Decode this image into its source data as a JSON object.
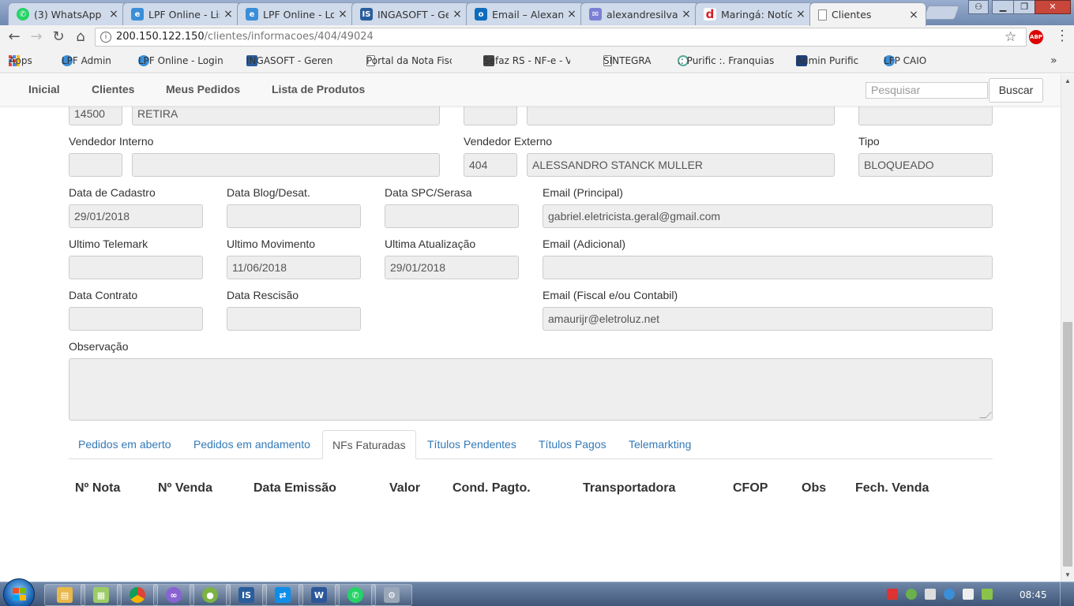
{
  "browser": {
    "tabs": [
      {
        "title": "(3) WhatsApp",
        "icon": "whatsapp-icon",
        "color": "#25d366"
      },
      {
        "title": "LPF Online - List",
        "icon": "lpf-icon",
        "color": "#3b8ed8"
      },
      {
        "title": "LPF Online - Loja",
        "icon": "lpf-icon",
        "color": "#3b8ed8"
      },
      {
        "title": "INGASOFT - Ger",
        "icon": "ingasoft-icon",
        "color": "#2a5d9c"
      },
      {
        "title": "Email – Alexand",
        "icon": "outlook-icon",
        "color": "#0f6cbd"
      },
      {
        "title": "alexandresilvapr",
        "icon": "mail-icon",
        "color": "#7b7fd4"
      },
      {
        "title": "Maringá: Notícia",
        "icon": "d-icon",
        "color": "#d61f2b"
      },
      {
        "title": "Clientes",
        "icon": "page-icon",
        "color": "#ffffff"
      }
    ],
    "address": {
      "host": "200.150.122.150",
      "path": "/clientes/informacoes/404/49024"
    },
    "abp_label": "ABP",
    "bookmarks": [
      {
        "label": "Apps",
        "icon": "apps-icon"
      },
      {
        "label": "LPF Admin",
        "icon": "lpf-icon"
      },
      {
        "label": "LPF Online - Login",
        "icon": "lpf-icon"
      },
      {
        "label": "INGASOFT - Gerencia",
        "icon": "ingasoft-icon"
      },
      {
        "label": "Portal da Nota Fiscal",
        "icon": "page-icon"
      },
      {
        "label": "Sefaz RS - NF-e - Val",
        "icon": "sefaz-icon"
      },
      {
        "label": "SINTEGRA",
        "icon": "page-icon"
      },
      {
        "label": ".: Purific :. Franquias",
        "icon": "purific-icon"
      },
      {
        "label": "Admin Purific",
        "icon": "p-icon"
      },
      {
        "label": "LFP CAIO",
        "icon": "lpf-icon"
      }
    ]
  },
  "nav": {
    "items": [
      "Inicial",
      "Clientes",
      "Meus Pedidos",
      "Lista de Produtos"
    ],
    "search_placeholder": "Pesquisar",
    "search_button": "Buscar"
  },
  "form": {
    "top_row": {
      "code": "14500",
      "name": "RETIRA"
    },
    "vendedor_interno": {
      "label": "Vendedor Interno",
      "code": "",
      "name": ""
    },
    "vendedor_externo": {
      "label": "Vendedor Externo",
      "code": "404",
      "name": "ALESSANDRO STANCK MULLER"
    },
    "tipo": {
      "label": "Tipo",
      "value": "BLOQUEADO"
    },
    "data_cadastro": {
      "label": "Data de Cadastro",
      "value": "29/01/2018"
    },
    "data_blog": {
      "label": "Data Blog/Desat.",
      "value": ""
    },
    "data_spc": {
      "label": "Data SPC/Serasa",
      "value": ""
    },
    "email_principal": {
      "label": "Email (Principal)",
      "value": "gabriel.eletricista.geral@gmail.com"
    },
    "ultimo_telemark": {
      "label": "Ultimo Telemark",
      "value": ""
    },
    "ultimo_movimento": {
      "label": "Ultimo Movimento",
      "value": "11/06/2018"
    },
    "ultima_atualizacao": {
      "label": "Ultima Atualização",
      "value": "29/01/2018"
    },
    "email_adicional": {
      "label": "Email (Adicional)",
      "value": ""
    },
    "data_contrato": {
      "label": "Data Contrato",
      "value": ""
    },
    "data_rescisao": {
      "label": "Data Rescisão",
      "value": ""
    },
    "email_fiscal": {
      "label": "Email (Fiscal e/ou Contabil)",
      "value": "amaurijr@eletroluz.net"
    },
    "observacao": {
      "label": "Observação",
      "value": ""
    }
  },
  "section_tabs": [
    "Pedidos em aberto",
    "Pedidos em andamento",
    "NFs Faturadas",
    "Títulos Pendentes",
    "Títulos Pagos",
    "Telemarkting"
  ],
  "active_section_tab": "NFs Faturadas",
  "table": {
    "columns": [
      "Nº Nota",
      "Nº Venda",
      "Data Emissão",
      "Valor",
      "Cond. Pagto.",
      "Transportadora",
      "CFOP",
      "Obs",
      "Fech. Venda"
    ],
    "rows": []
  },
  "taskbar": {
    "apps": [
      {
        "icon": "explorer-icon",
        "color": "#e8b84a"
      },
      {
        "icon": "folders-icon",
        "color": "#9ccc65"
      },
      {
        "icon": "chrome-icon",
        "color": "#db4437"
      },
      {
        "icon": "app-swirl-icon",
        "color": "#8a63d2"
      },
      {
        "icon": "app-green-icon",
        "color": "#7cb342"
      },
      {
        "icon": "ingasoft-icon",
        "color": "#2a5d9c"
      },
      {
        "icon": "teamviewer-icon",
        "color": "#0e8ee9"
      },
      {
        "icon": "word-icon",
        "color": "#2b579a"
      },
      {
        "icon": "whatsapp-icon",
        "color": "#25d366"
      },
      {
        "icon": "network-icon",
        "color": "#9aa7b8"
      }
    ],
    "clock": "08:45"
  },
  "colors": {
    "link": "#337ab7",
    "field_bg": "#eeeeee",
    "navbar_bg": "#f8f8f8"
  }
}
